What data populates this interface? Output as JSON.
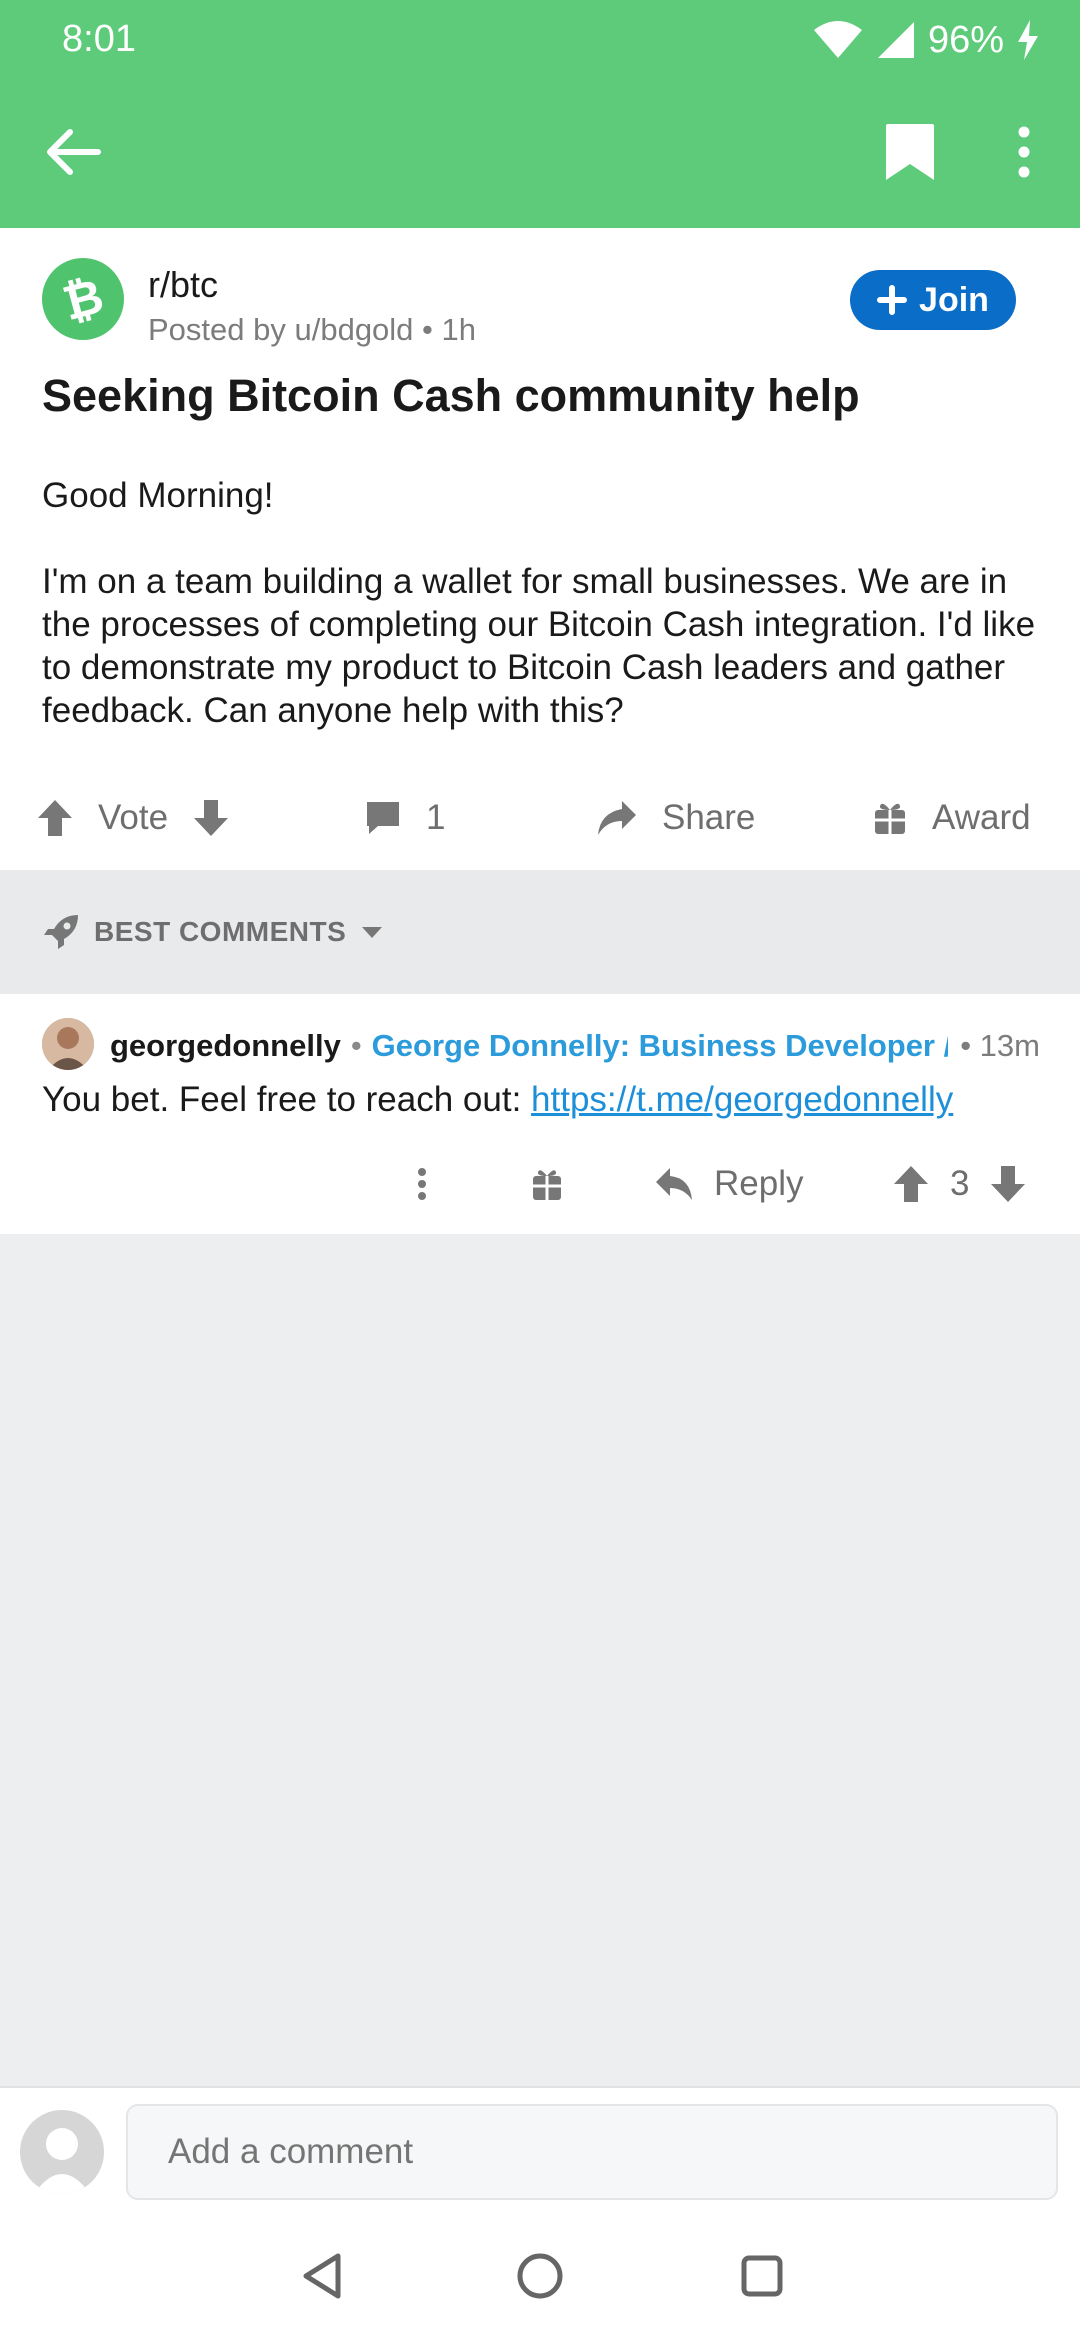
{
  "status_bar": {
    "time": "8:01",
    "battery": "96%"
  },
  "colors": {
    "toolbar": "#5ecb7a",
    "join": "#0a6dc8",
    "link": "#1d8fd8",
    "flair": "#2b9bdc"
  },
  "post": {
    "subreddit": "r/btc",
    "posted_by": "Posted by u/bdgold • 1h",
    "join_label": "Join",
    "title": "Seeking Bitcoin Cash community help",
    "body_p1": "Good Morning!",
    "body_p2": "I'm on a team building a wallet for small businesses. We are in the processes of completing our Bitcoin Cash integration. I'd like to demonstrate my product to Bitcoin Cash leaders and gather feedback. Can anyone help with this?",
    "vote_label": "Vote",
    "comment_count": "1",
    "share_label": "Share",
    "award_label": "Award"
  },
  "sort": {
    "label": "BEST COMMENTS"
  },
  "comment": {
    "username": "georgedonnelly",
    "flair": "George Donnelly: Business Developer / ...",
    "time": "• 13m",
    "text": "You bet. Feel free to reach out: ",
    "link": "https://t.me/georgedonnelly",
    "reply_label": "Reply",
    "score": "3"
  },
  "composer": {
    "placeholder": "Add a comment"
  }
}
